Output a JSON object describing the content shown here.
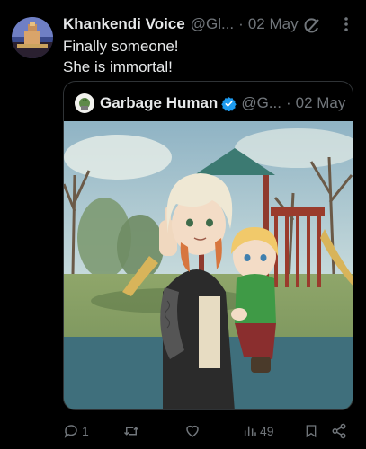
{
  "tweet": {
    "author_name": "Khankendi Voice",
    "author_handle": "@Gl...",
    "separator": "·",
    "date": "02 May",
    "text_lines": [
      "Finally someone!",
      "She is immortal!"
    ]
  },
  "quoted_tweet": {
    "author_name": "Garbage Human",
    "author_handle": "@G...",
    "separator": "·",
    "date": "02 May",
    "image_description_icon": "anime-illustration-image"
  },
  "actions": {
    "reply_count": "1",
    "retweet_count": "",
    "like_count": "",
    "views_count": "49"
  },
  "colors": {
    "background": "#000000",
    "text": "#e7e9ea",
    "secondary": "#71767b",
    "border": "#2f3336",
    "verified": "#1d9bf0"
  }
}
